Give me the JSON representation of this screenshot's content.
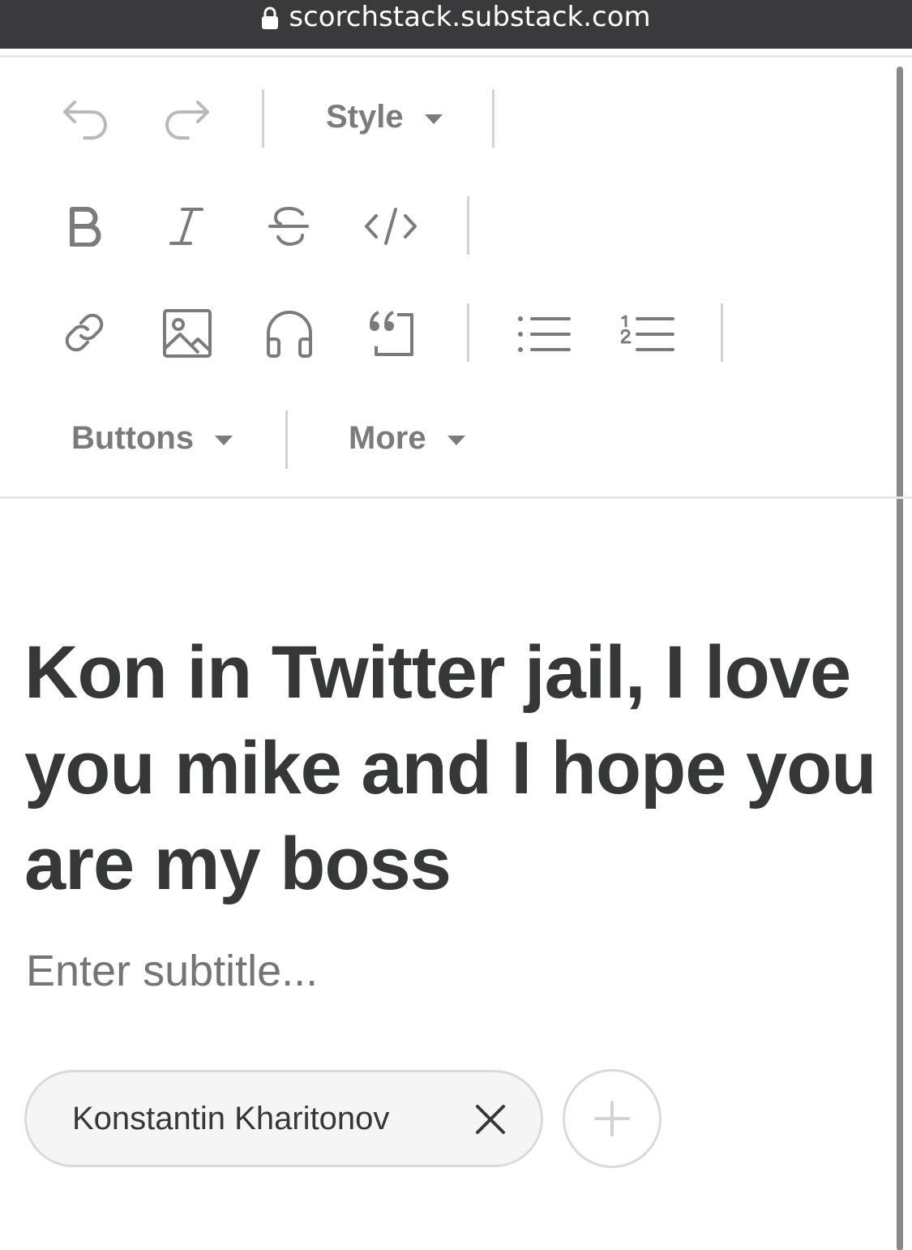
{
  "browser": {
    "url": "scorchstack.substack.com",
    "icons": {
      "lock": "lock-icon"
    }
  },
  "toolbar": {
    "row1": {
      "undo_icon": "undo-icon",
      "redo_icon": "redo-icon",
      "style_label": "Style"
    },
    "row2": {
      "bold_icon": "bold-icon",
      "italic_icon": "italic-icon",
      "strikethrough_icon": "strikethrough-icon",
      "code_icon": "code-icon"
    },
    "row3": {
      "link_icon": "link-icon",
      "image_icon": "image-icon",
      "audio_icon": "headphones-icon",
      "quote_icon": "quote-icon",
      "bullet_list_icon": "bullet-list-icon",
      "numbered_list_icon": "numbered-list-icon"
    },
    "row4": {
      "buttons_label": "Buttons",
      "more_label": "More"
    },
    "colors": {
      "icon": "#7b7b7b",
      "icon_disabled": "#b9b9b9",
      "separator": "#d3d3d3"
    }
  },
  "editor": {
    "title": "Kon in Twitter jail, I love you mike and I hope you are my boss",
    "subtitle_placeholder": "Enter subtitle...",
    "authors": [
      {
        "name": "Konstantin Kharitonov"
      }
    ],
    "icons": {
      "remove": "close-icon",
      "add": "plus-icon"
    }
  }
}
